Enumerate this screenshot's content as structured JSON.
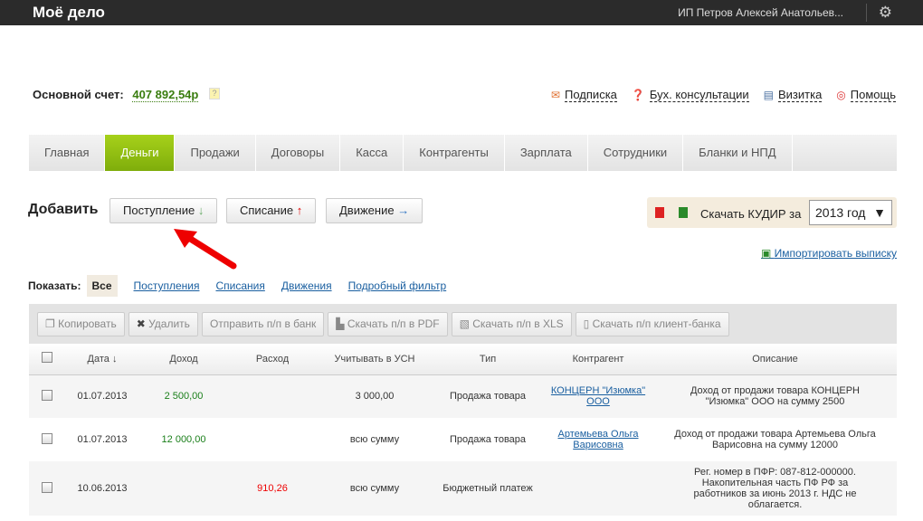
{
  "header": {
    "logo": "Моё дело",
    "user": "ИП Петров Алексей Анатольев...",
    "gear_icon": "gear-icon"
  },
  "account": {
    "label": "Основной счет:",
    "value": "407 892,54р",
    "help": "?"
  },
  "links": [
    {
      "icon": "envelope-icon",
      "label": "Подписка"
    },
    {
      "icon": "question-icon",
      "label": "Бух. консультации"
    },
    {
      "icon": "card-icon",
      "label": "Визитка"
    },
    {
      "icon": "lifebuoy-icon",
      "label": "Помощь"
    }
  ],
  "nav": [
    "Главная",
    "Деньги",
    "Продажи",
    "Договоры",
    "Касса",
    "Контрагенты",
    "Зарплата",
    "Сотрудники",
    "Бланки и НПД"
  ],
  "nav_active": "Деньги",
  "add": {
    "label": "Добавить",
    "buttons": [
      {
        "label": "Поступление",
        "arrow": "↓"
      },
      {
        "label": "Списание",
        "arrow": "↑"
      },
      {
        "label": "Движение",
        "arrow": "→"
      }
    ]
  },
  "kudir": {
    "label": "Скачать КУДИР за",
    "year": "2013 год"
  },
  "import": "Импортировать выписку",
  "filter": {
    "label": "Показать:",
    "items": [
      "Все",
      "Поступления",
      "Списания",
      "Движения",
      "Подробный фильтр"
    ]
  },
  "toolbar": [
    "Копировать",
    "Удалить",
    "Отправить п/п в банк",
    "Скачать п/п в PDF",
    "Скачать п/п в XLS",
    "Скачать п/п клиент-банка"
  ],
  "table": {
    "headers": [
      "Дата ↓",
      "Доход",
      "Расход",
      "Учитывать в УСН",
      "Тип",
      "Контрагент",
      "Описание"
    ],
    "rows": [
      {
        "date": "01.07.2013",
        "income": "2 500,00",
        "expense": "",
        "usn": "3 000,00",
        "type": "Продажа товара",
        "contractor": "КОНЦЕРН \"Изюмка\" ООО",
        "desc": "Доход от продажи товара КОНЦЕРН \"Изюмка\" ООО на сумму 2500"
      },
      {
        "date": "01.07.2013",
        "income": "12 000,00",
        "expense": "",
        "usn": "всю сумму",
        "type": "Продажа товара",
        "contractor": "Артемьева Ольга Варисовна",
        "desc": "Доход от продажи товара Артемьева Ольга Варисовна на сумму 12000"
      },
      {
        "date": "10.06.2013",
        "income": "",
        "expense": "910,26",
        "usn": "всю сумму",
        "type": "Бюджетный платеж",
        "contractor": "",
        "desc": "Рег. номер в ПФР: 087-812-000000. Накопительная часть ПФ РФ за работников за июнь 2013 г. НДС не облагается."
      }
    ]
  },
  "colors": {
    "accent": "#8bbd0f",
    "income": "#1a7f1a",
    "expense": "#e00000",
    "link": "#1a5fa0"
  }
}
